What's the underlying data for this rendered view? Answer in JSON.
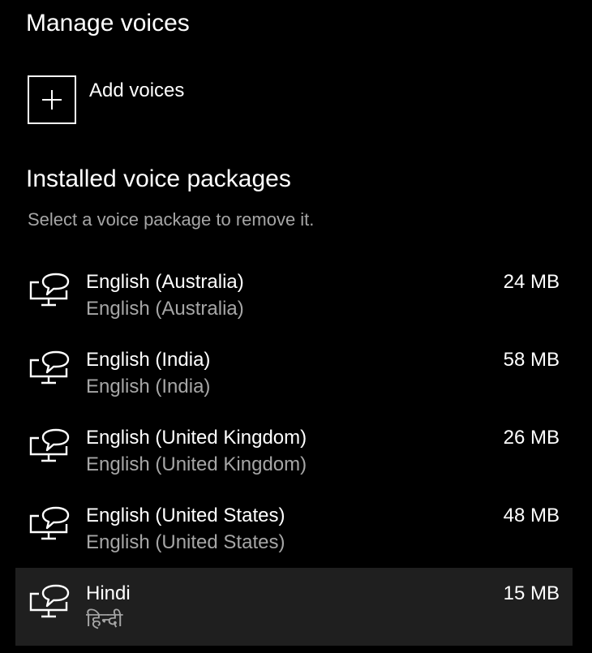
{
  "page": {
    "title": "Manage voices"
  },
  "add_voices": {
    "label": "Add voices",
    "icon": "plus-icon"
  },
  "installed": {
    "title": "Installed voice packages",
    "hint": "Select a voice package to remove it."
  },
  "packages": [
    {
      "name": "English (Australia)",
      "native_name": "English (Australia)",
      "size": "24 MB",
      "icon": "speech-monitor-icon"
    },
    {
      "name": "English (India)",
      "native_name": "English (India)",
      "size": "58 MB",
      "icon": "speech-monitor-icon"
    },
    {
      "name": "English (United Kingdom)",
      "native_name": "English (United Kingdom)",
      "size": "26 MB",
      "icon": "speech-monitor-icon"
    },
    {
      "name": "English (United States)",
      "native_name": "English (United States)",
      "size": "48 MB",
      "icon": "speech-monitor-icon"
    },
    {
      "name": "Hindi",
      "native_name": "हिन्दी",
      "size": "15 MB",
      "icon": "speech-monitor-icon",
      "selected": true
    }
  ],
  "colors": {
    "background": "#000000",
    "text": "#ffffff",
    "secondary_text": "#a6a6a6",
    "selected_row": "#1f1f1f"
  }
}
